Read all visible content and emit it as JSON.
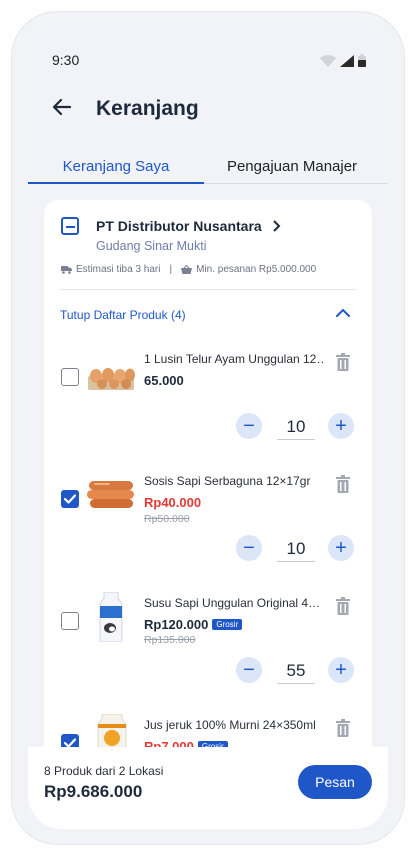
{
  "status": {
    "time": "9:30"
  },
  "header": {
    "title": "Keranjang"
  },
  "tabs": [
    {
      "label": "Keranjang Saya"
    },
    {
      "label": "Pengajuan Manajer"
    }
  ],
  "supplier": {
    "name": "PT Distributor Nusantara",
    "warehouse": "Gudang Sinar Mukti",
    "delivery": "Estimasi tiba 3 hari",
    "separator": "|",
    "min_order": "Min. pesanan Rp5.000.000",
    "toggle_label": "Tutup Daftar Produk (4)"
  },
  "products": [
    {
      "name": "1 Lusin Telur Ayam Unggulan 12…",
      "price": "65.000",
      "old_price": "",
      "badge": "",
      "qty": "10",
      "checked": false
    },
    {
      "name": "Sosis Sapi Serbaguna 12×17gr",
      "price": "Rp40.000",
      "old_price": "Rp50.000",
      "badge": "",
      "qty": "10",
      "checked": true
    },
    {
      "name": "Susu Sapi Unggulan Original 4…",
      "price": "Rp120.000",
      "old_price": "Rp135.000",
      "badge": "Grosir",
      "qty": "55",
      "checked": false
    },
    {
      "name": "Jus jeruk 100% Murni 24×350ml",
      "price": "Rp7.000",
      "old_price": "",
      "badge": "Grosir",
      "qty": "",
      "checked": true
    }
  ],
  "footer": {
    "summary": "8 Produk dari 2 Lokasi",
    "total": "Rp9.686.000",
    "order_label": "Pesan"
  },
  "colors": {
    "accent": "#1f57c8",
    "sale": "#e53935"
  }
}
